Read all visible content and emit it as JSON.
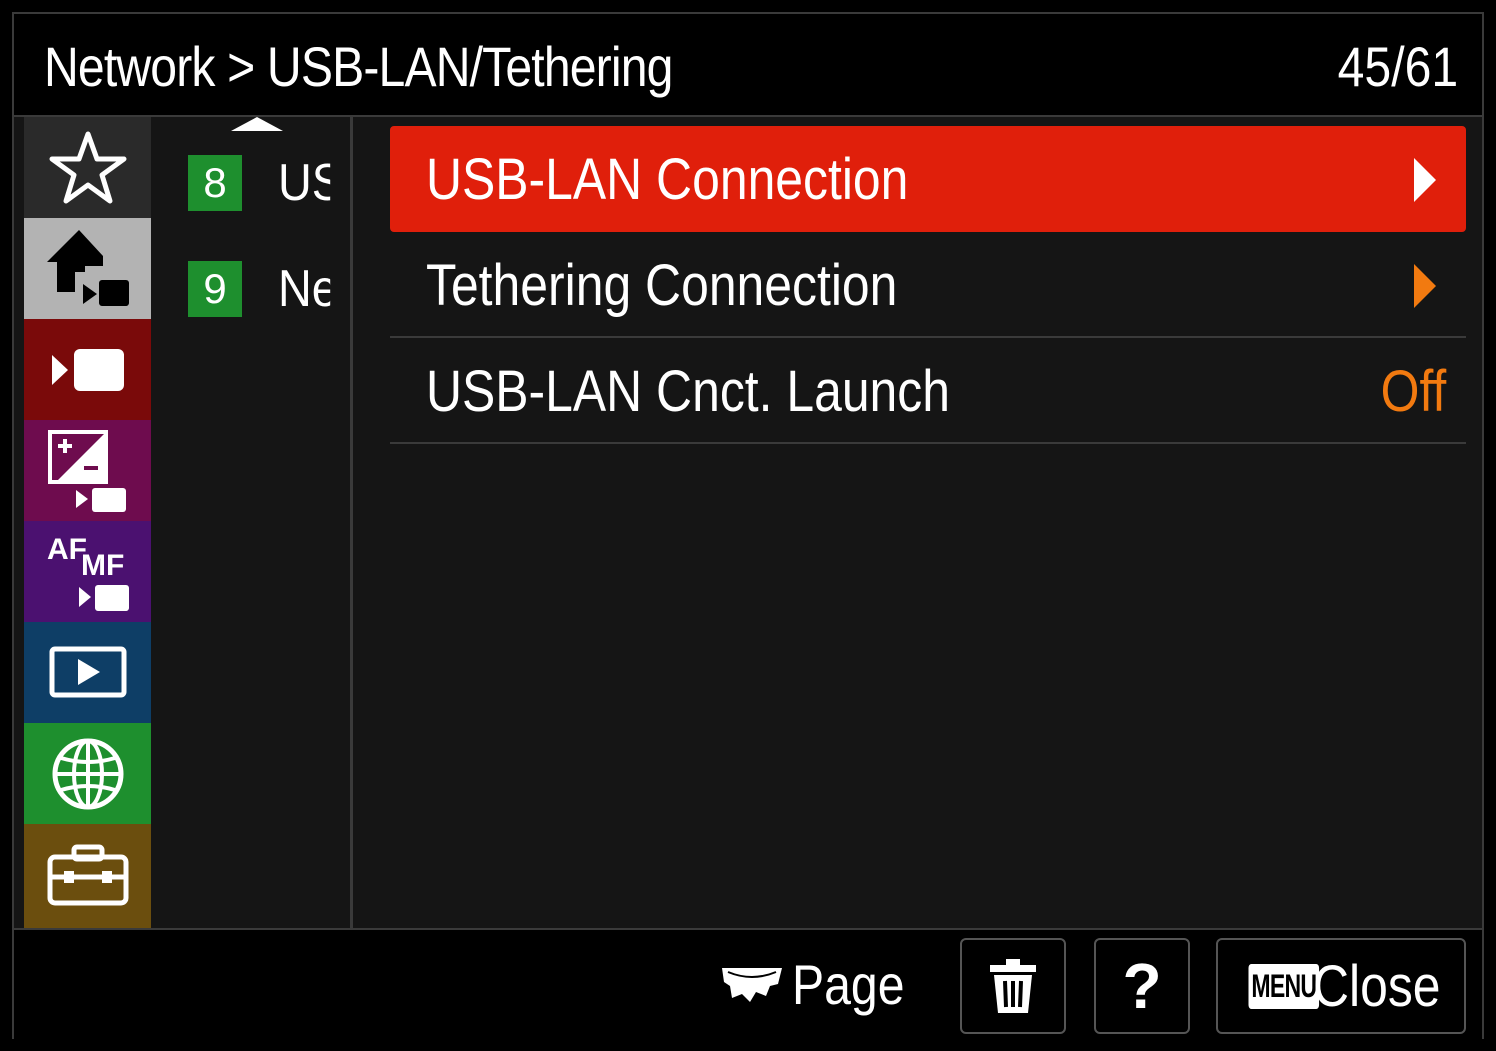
{
  "header": {
    "breadcrumb": "Network > USB-LAN/Tethering",
    "page_counter": "45/61"
  },
  "categories": [
    {
      "name": "favorites",
      "icon": "star-icon",
      "color": "#2a2a2a",
      "selected": false
    },
    {
      "name": "shooting",
      "icon": "camera-home-icon",
      "color": "#b3b3b3",
      "selected": true
    },
    {
      "name": "movie",
      "icon": "movie-icon",
      "color": "#7a0a0a",
      "selected": false
    },
    {
      "name": "exposure-color",
      "icon": "exposure-icon",
      "color": "#6e0c4e",
      "selected": false
    },
    {
      "name": "focus",
      "icon": "af-mf-icon",
      "color": "#4b1170",
      "selected": false
    },
    {
      "name": "playback",
      "icon": "playback-icon",
      "color": "#0e3e66",
      "selected": false
    },
    {
      "name": "network",
      "icon": "globe-icon",
      "color": "#1e8f2e",
      "selected": false
    },
    {
      "name": "setup",
      "icon": "toolbox-icon",
      "color": "#6b4e0e",
      "selected": false
    }
  ],
  "categories_af_labels": {
    "af": "AF",
    "mf": "MF"
  },
  "pages": [
    {
      "number": "8",
      "label": "US"
    },
    {
      "number": "9",
      "label": "Ne"
    }
  ],
  "menu_items": [
    {
      "label": "USB-LAN Connection",
      "type": "submenu",
      "selected": true
    },
    {
      "label": "Tethering Connection",
      "type": "submenu",
      "selected": false
    },
    {
      "label": "USB-LAN Cnct. Launch",
      "type": "value",
      "value": "Off",
      "selected": false
    }
  ],
  "footer": {
    "page_label": "Page",
    "help_label": "?",
    "menu_badge": "MENU",
    "close_label": "Close"
  },
  "colors": {
    "accent_red": "#e01f0b",
    "value_orange": "#f27a10",
    "page_green": "#1e8f2e"
  }
}
